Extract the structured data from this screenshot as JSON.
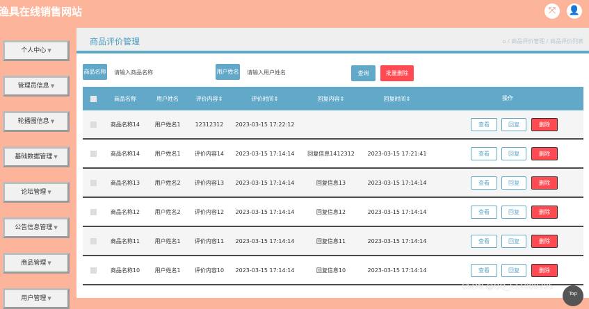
{
  "header": {
    "site_title": "渔具在线销售网站"
  },
  "top_icons": {
    "fullscreen": "⤧",
    "user": "👤"
  },
  "sidebar": {
    "items": [
      {
        "label": "个人中心"
      },
      {
        "label": "管理员信息"
      },
      {
        "label": "轮播图信息"
      },
      {
        "label": "基础数据管理"
      },
      {
        "label": "论坛管理"
      },
      {
        "label": "公告信息管理"
      },
      {
        "label": "商品管理"
      },
      {
        "label": "用户管理"
      }
    ]
  },
  "page": {
    "title": "商品评价管理",
    "breadcrumb": {
      "home_icon": "⌂",
      "sep": "/",
      "level1": "商品评价管理",
      "level2": "商品评价列表"
    }
  },
  "search": {
    "product_label": "商品名称",
    "product_placeholder": "请输入商品名称",
    "user_label": "用户姓名",
    "user_placeholder": "请输入用户姓名",
    "query_button": "查询",
    "batch_delete_button": "批量删除"
  },
  "table": {
    "columns": [
      "商品名称",
      "用户姓名",
      "评价内容",
      "评价时间",
      "回复内容",
      "回复时间",
      "操作"
    ],
    "rows": [
      {
        "product": "商品名称14",
        "user": "用户姓名1",
        "content": "12312312",
        "time": "2023-03-15 17:22:12",
        "reply": "",
        "reply_time": ""
      },
      {
        "product": "商品名称14",
        "user": "用户姓名1",
        "content": "评价内容14",
        "time": "2023-03-15 17:14:14",
        "reply": "回复信息1412312",
        "reply_time": "2023-03-15 17:21:41"
      },
      {
        "product": "商品名称13",
        "user": "用户姓名2",
        "content": "评价内容13",
        "time": "2023-03-15 17:14:14",
        "reply": "回复信息13",
        "reply_time": "2023-03-15 17:14:14"
      },
      {
        "product": "商品名称12",
        "user": "用户姓名2",
        "content": "评价内容12",
        "time": "2023-03-15 17:14:14",
        "reply": "回复信息12",
        "reply_time": "2023-03-15 17:14:14"
      },
      {
        "product": "商品名称11",
        "user": "用户姓名1",
        "content": "评价内容11",
        "time": "2023-03-15 17:14:14",
        "reply": "回复信息11",
        "reply_time": "2023-03-15 17:14:14"
      },
      {
        "product": "商品名称10",
        "user": "用户姓名1",
        "content": "评价内容10",
        "time": "2023-03-15 17:14:14",
        "reply": "回复信息10",
        "reply_time": "2023-03-15 17:14:14"
      }
    ],
    "actions": {
      "view": "查看",
      "reply": "回复",
      "delete": "删除"
    }
  },
  "watermark": "CSDN @QQ_511008285",
  "top_button": "Top",
  "colors": {
    "accent": "#62a8c9",
    "danger": "#ff4a52",
    "sidebar_bg": "#fcb59a"
  }
}
